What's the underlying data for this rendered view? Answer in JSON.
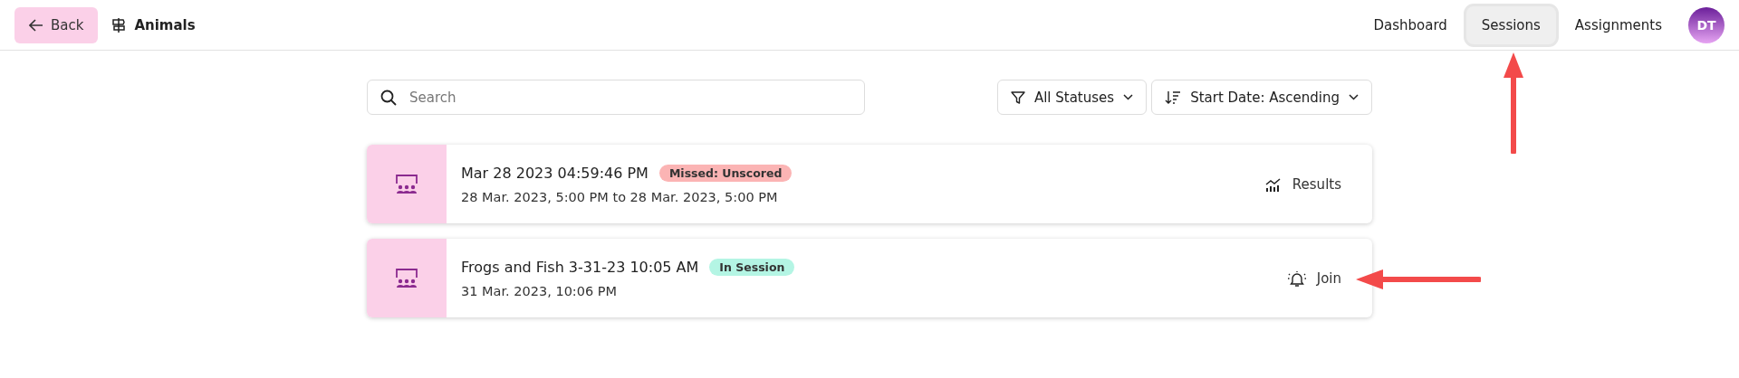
{
  "header": {
    "back_button": "Back",
    "title": "Animals",
    "nav": [
      {
        "label": "Dashboard",
        "selected": false
      },
      {
        "label": "Sessions",
        "selected": true
      },
      {
        "label": "Assignments",
        "selected": false
      }
    ],
    "avatar": "DT"
  },
  "search": {
    "placeholder": "Search"
  },
  "filters": [
    {
      "kind": "filter",
      "label": "All Statuses"
    },
    {
      "kind": "sort",
      "label": "Start Date: Ascending"
    }
  ],
  "sessions": [
    {
      "title": "Mar 28 2023 04:59:46 PM",
      "status": "Missed: Unscored",
      "color": "#fbb4b4",
      "dates": "28 Mar. 2023, 5:00 PM to 28 Mar. 2023, 5:00 PM",
      "action": {
        "kind": "results",
        "label": "Results"
      }
    },
    {
      "title": "Frogs and Fish 3-31-23 10:05 AM",
      "status": "In Session",
      "color": "#b4f5e4",
      "dates": "31 Mar. 2023, 10:06 PM",
      "action": {
        "kind": "join",
        "label": "Join"
      }
    }
  ]
}
